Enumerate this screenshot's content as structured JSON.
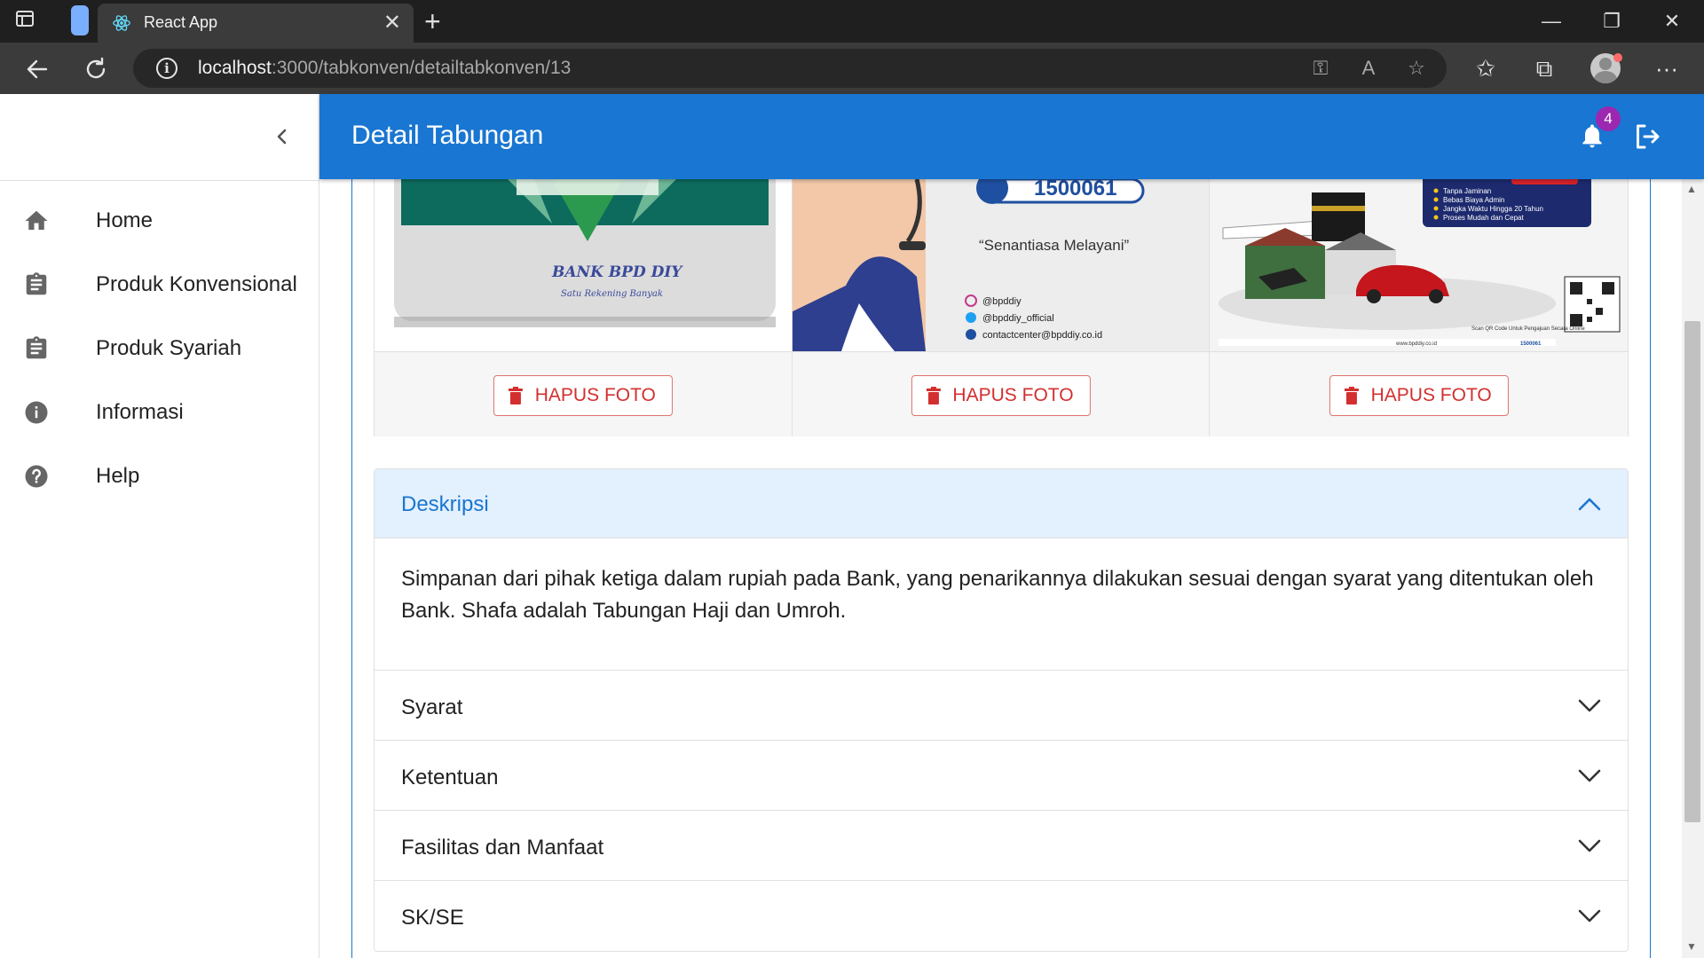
{
  "browser": {
    "tab_title": "React App",
    "url_host": "localhost",
    "url_rest": ":3000/tabkonven/detailtabkonven/13"
  },
  "sidebar": {
    "items": [
      {
        "label": "Home",
        "icon": "home-icon"
      },
      {
        "label": "Produk Konvensional",
        "icon": "clipboard-icon"
      },
      {
        "label": "Produk Syariah",
        "icon": "clipboard-icon"
      },
      {
        "label": "Informasi",
        "icon": "info-icon"
      },
      {
        "label": "Help",
        "icon": "help-icon"
      }
    ]
  },
  "appbar": {
    "title": "Detail Tabungan",
    "notification_count": "4"
  },
  "photos": [
    {
      "delete_label": "HAPUS FOTO",
      "bank_text": "BANK BPD DIY",
      "bank_sub": "Satu Rekening Banyak"
    },
    {
      "delete_label": "HAPUS FOTO",
      "phone": "1500061",
      "tagline": "“Senantiasa Melayani”",
      "instagram": "@bpddiy",
      "twitter": "@bpddiy_official",
      "email": "contactcenter@bpddiy.co.id"
    },
    {
      "delete_label": "HAPUS FOTO",
      "features": [
        "Tanpa Jaminan",
        "Bebas Biaya Admin",
        "Jangka Waktu Hingga 20 Tahun",
        "Proses Mudah dan Cepat"
      ],
      "qr_caption": "Scan QR Code Untuk Pengajuan Secara Online",
      "small_phone": "1500061",
      "small_site": "www.bpddiy.co.id"
    }
  ],
  "accordion": {
    "open_title": "Deskripsi",
    "open_body": "Simpanan dari pihak ketiga dalam rupiah pada Bank, yang penarikannya dilakukan sesuai dengan syarat yang ditentukan oleh Bank. Shafa adalah Tabungan Haji dan Umroh.",
    "sections": [
      "Syarat",
      "Ketentuan",
      "Fasilitas dan Manfaat",
      "SK/SE"
    ]
  },
  "colors": {
    "primary": "#1976d2",
    "danger": "#d32f2f",
    "badge": "#9c27b0",
    "accordion_open_bg": "#e3f0fd"
  }
}
